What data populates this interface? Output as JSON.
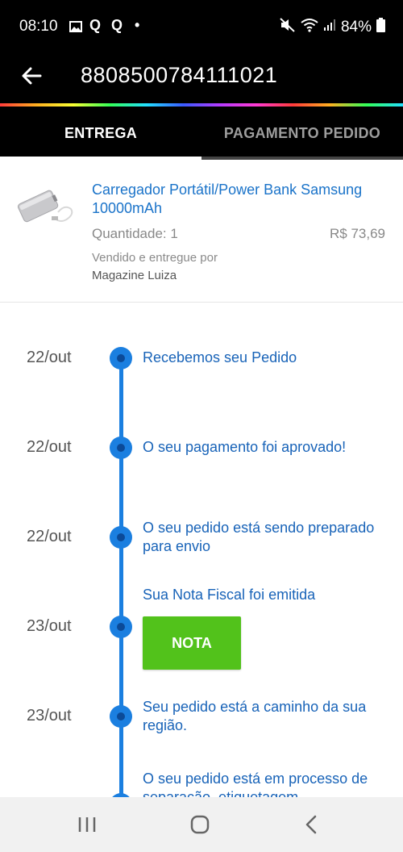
{
  "status_bar": {
    "time": "08:10",
    "notif_q1": "Q",
    "notif_q2": "Q",
    "notif_dot": "•",
    "battery": "84%"
  },
  "header": {
    "order_number": "8808500784111021"
  },
  "tabs": [
    {
      "label": "ENTREGA",
      "active": true
    },
    {
      "label": "PAGAMENTO PEDIDO",
      "active": false
    }
  ],
  "product": {
    "name": "Carregador Portátil/Power Bank Samsung 10000mAh",
    "quantity": "Quantidade: 1",
    "price": "R$ 73,69",
    "sold_by_label": "Vendido e entregue por",
    "seller": "Magazine Luiza"
  },
  "timeline": [
    {
      "date": "22/out",
      "text": "Recebemos seu Pedido"
    },
    {
      "date": "22/out",
      "text": "O seu pagamento foi aprovado!"
    },
    {
      "date": "22/out",
      "text": "O seu pedido está sendo preparado para envio"
    },
    {
      "date": "23/out",
      "text": "Sua Nota Fiscal foi emitida",
      "button": "NOTA"
    },
    {
      "date": "23/out",
      "text": "Seu pedido está a caminho da sua região."
    },
    {
      "date": "",
      "text": "O seu pedido está em processo de separação, etiquetagem"
    }
  ],
  "colors": {
    "accent_blue": "#1b7fe0",
    "link_blue": "#1a73c9",
    "button_green": "#52c21b",
    "header_bg": "#000000"
  }
}
